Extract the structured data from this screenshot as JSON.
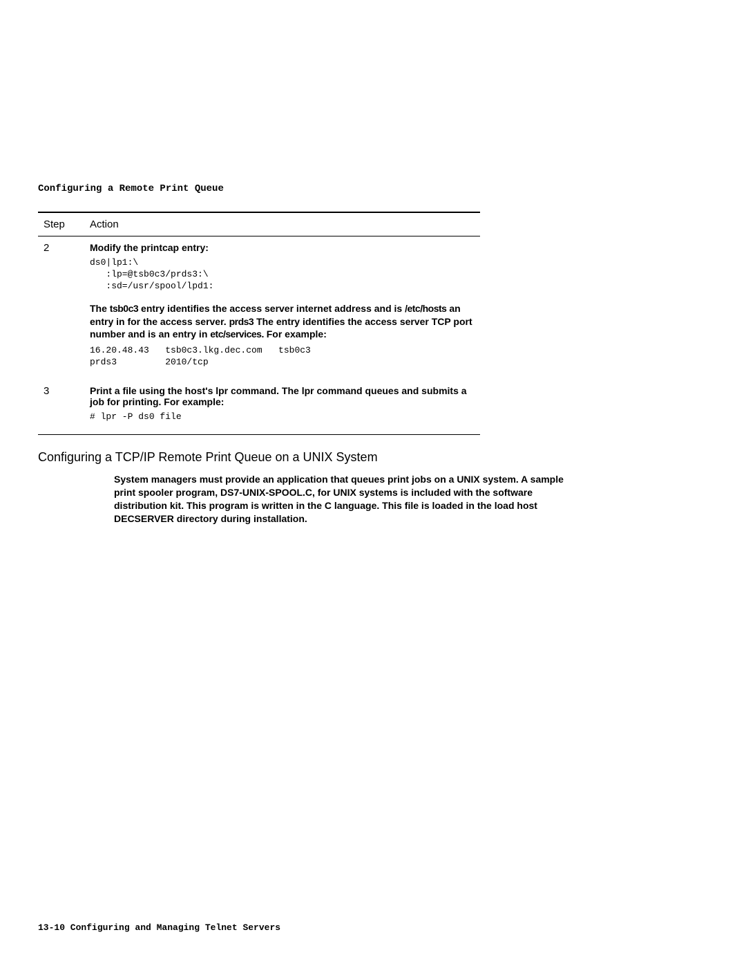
{
  "header": {
    "title": "Configuring a Remote Print Queue"
  },
  "table": {
    "col1": "Step",
    "col2": "Action",
    "row2": {
      "step": "2",
      "action_title": "Modify the printcap entry:",
      "code1": "ds0|lp1:\\\n   :lp=@tsb0c3/prds3:\\\n   :sd=/usr/spool/lpd1:",
      "para_parts": {
        "p1": "The ",
        "p2": "tsb0c3",
        "p3": " entry identifies the access server internet address and is ",
        "p4": "/etc/hosts",
        "p5": " an entry in for the access server. ",
        "p6": "prds3",
        "p7": " The entry identifies the access server TCP port number and is an entry in ",
        "p8": "etc/services.",
        "p9": " For example:"
      },
      "code2": "16.20.48.43   tsb0c3.lkg.dec.com   tsb0c3\nprds3         2010/tcp"
    },
    "row3": {
      "step": "3",
      "action_text": "Print a file using the host's lpr command. The lpr command queues and submits a job for printing. For example:",
      "code": "# lpr -P ds0 file"
    }
  },
  "subsection": {
    "title": "Configuring a TCP/IP Remote Print Queue on a UNIX System",
    "para": "System managers must provide an application that queues print jobs on a UNIX system. A sample print spooler program, DS7-UNIX-SPOOL.C, for UNIX systems is included with the software distribution kit. This program is written in the C language. This file is loaded in the load host DECSERVER directory during installation."
  },
  "footer": {
    "text": "13-10  Configuring and Managing Telnet Servers"
  }
}
